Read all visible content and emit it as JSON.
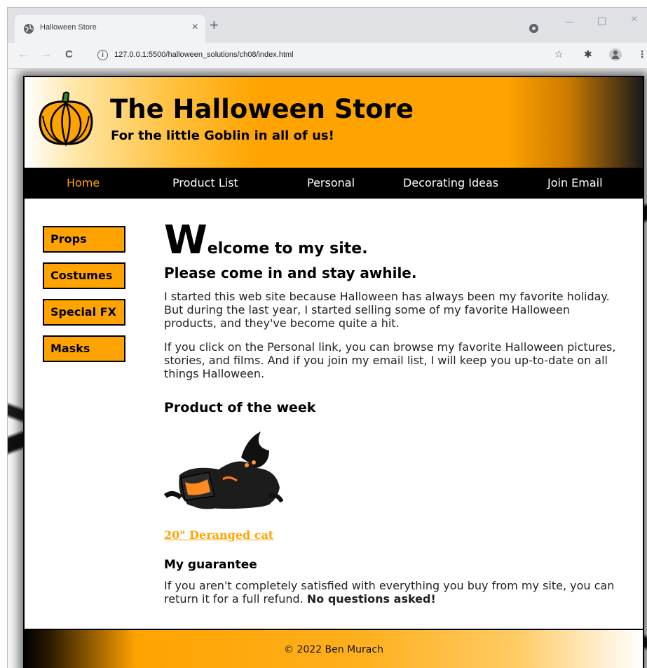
{
  "browser": {
    "tab_title": "Halloween Store",
    "tab_close": "×",
    "new_tab": "+",
    "address_url": "127.0.0.1:5500/halloween_solutions/ch08/index.html",
    "nav_back": "←",
    "nav_forward": "→",
    "nav_reload": "C",
    "info_glyph": "i",
    "star_icon": "☆",
    "extensions_icon": "✱",
    "menu_icon": "⋮",
    "win_close": "×"
  },
  "site": {
    "title": "The Halloween Store",
    "tagline": "For the little Goblin in all of us!",
    "accent_color": "#ffa300",
    "nav": [
      {
        "label": "Home",
        "current": true
      },
      {
        "label": "Product List",
        "current": false
      },
      {
        "label": "Personal",
        "current": false
      },
      {
        "label": "Decorating Ideas",
        "current": false
      },
      {
        "label": "Join Email",
        "current": false
      }
    ],
    "sidebar": [
      {
        "label": "Props"
      },
      {
        "label": "Costumes"
      },
      {
        "label": "Special FX"
      },
      {
        "label": "Masks"
      }
    ],
    "main": {
      "welcome_dropcap": "W",
      "welcome_rest": "elcome to my site.",
      "subheading": "Please come in and stay awhile.",
      "paragraph1": "I started this web site because Halloween has always been my favorite holiday. But during the last year, I started selling some of my favorite Halloween products, and they've become quite a hit.",
      "paragraph2": "If you click on the Personal link, you can browse my favorite Halloween pictures, stories, and films. And if you join my email list, I will keep you up-to-date on all things Halloween.",
      "product_heading": "Product of the week",
      "product_link": "20\" Deranged cat",
      "guarantee_heading": "My guarantee",
      "guarantee_text": "If you aren't completely satisfied with everything you buy from my site, you can return it for a full refund. ",
      "guarantee_bold": "No questions asked!"
    },
    "footer": {
      "copyright": "© 2022 Ben Murach"
    }
  }
}
